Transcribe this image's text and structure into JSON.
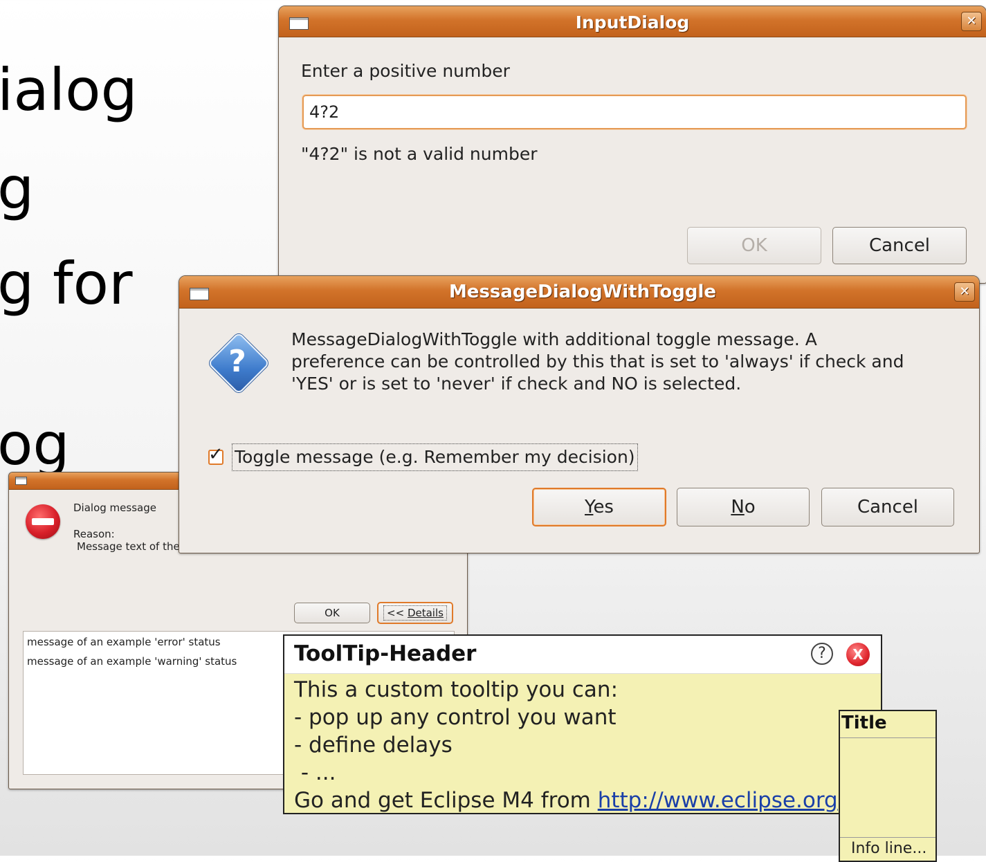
{
  "slide": {
    "lines": [
      "ialog",
      "g",
      "g for",
      "og"
    ]
  },
  "input_dialog": {
    "title": "InputDialog",
    "close_glyph": "✕",
    "prompt": "Enter a positive number",
    "value": "4?2",
    "error": "\"4?2\" is not a valid number",
    "ok_label": "OK",
    "cancel_label": "Cancel"
  },
  "message_dialog": {
    "title": "MessageDialogWithToggle",
    "close_glyph": "✕",
    "icon": "question-icon",
    "icon_glyph": "?",
    "message": "MessageDialogWithToggle with additional toggle message. A\npreference can be controlled by this that is set to 'always' if check and\n'YES' or is set to 'never' if check and NO is selected.",
    "toggle_label": "Toggle message (e.g. Remember my decision)",
    "toggle_checked": true,
    "yes_label": "Yes",
    "yes_mnemonic": "Y",
    "no_label": "No",
    "no_mnemonic": "N",
    "cancel_label": "Cancel"
  },
  "error_dialog": {
    "icon": "error-icon",
    "message": "Dialog message",
    "reason_label": "Reason:",
    "reason_text": "Message text of the",
    "ok_label": "OK",
    "details_prefix": "<< ",
    "details_label": "Details",
    "details_items": [
      "message of an example 'error' status",
      "message of an example 'warning' status"
    ]
  },
  "tooltip": {
    "header": "ToolTip-Header",
    "help_icon": "help-icon",
    "close_icon": "close-icon",
    "lines": [
      "This a custom tooltip you can:",
      "- pop up any control you want",
      "- define delays",
      " - ..."
    ],
    "link_prefix": "Go and get Eclipse M4 from ",
    "link_text": "http://www.eclipse.org"
  },
  "mini_tooltip": {
    "title": "Title",
    "info": "Info line..."
  },
  "colors": {
    "titlebar_orange": "#d2732a",
    "tooltip_yellow": "#f4f1b4",
    "link_blue": "#1a3fa8",
    "error_red": "#d8202a",
    "question_blue": "#3f7ccc"
  }
}
